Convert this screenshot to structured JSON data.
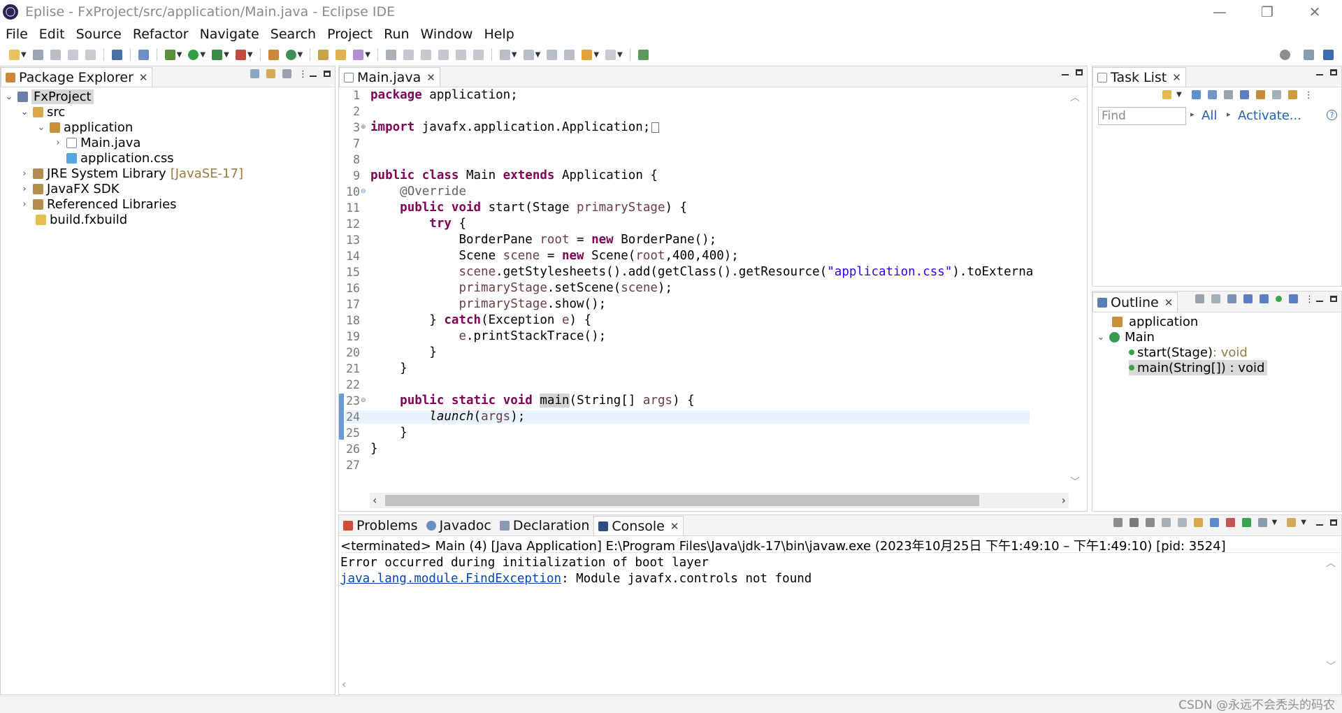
{
  "titlebar": {
    "title": "Eplise - FxProject/src/application/Main.java - Eclipse IDE",
    "minimize_glyph": "—",
    "restore_glyph": "❐",
    "close_glyph": "✕"
  },
  "menu": {
    "items": [
      "File",
      "Edit",
      "Source",
      "Refactor",
      "Navigate",
      "Search",
      "Project",
      "Run",
      "Window",
      "Help"
    ]
  },
  "package_explorer": {
    "tab_label": "Package Explorer",
    "tree": [
      {
        "label": "FxProject",
        "icon": "project-icon"
      },
      {
        "label": "src",
        "icon": "source-folder-icon"
      },
      {
        "label": "application",
        "icon": "package-icon"
      },
      {
        "label": "Main.java",
        "icon": "java-file-icon"
      },
      {
        "label": "application.css",
        "icon": "css-file-icon"
      },
      {
        "label": "JRE System Library",
        "suffix": "[JavaSE-17]",
        "icon": "library-icon"
      },
      {
        "label": "JavaFX SDK",
        "icon": "library-icon"
      },
      {
        "label": "Referenced Libraries",
        "icon": "library-icon"
      },
      {
        "label": "build.fxbuild",
        "icon": "fxbuild-file-icon"
      }
    ]
  },
  "editor": {
    "tab_label": "Main.java",
    "line_numbers": [
      "1",
      "2",
      "3",
      "7",
      "8",
      "9",
      "10",
      "11",
      "12",
      "13",
      "14",
      "15",
      "16",
      "17",
      "18",
      "19",
      "20",
      "21",
      "22",
      "23",
      "24",
      "25",
      "26",
      "27"
    ],
    "code": {
      "l1_kw": "package",
      "l1_rest": " application;",
      "l3_kw": "import",
      "l3_rest": " javafx.application.Application;",
      "l9_kw1": "public",
      "l9_kw2": "class",
      "l9_name": " Main ",
      "l9_kw3": "extends",
      "l9_rest": " Application {",
      "l10_ann": "@Override",
      "l11_kw1": "public",
      "l11_kw2": "void",
      "l11_rest1": " start(Stage ",
      "l11_var": "primaryStage",
      "l11_rest2": ") {",
      "l12_kw": "try",
      "l12_rest": " {",
      "l13_a": "BorderPane ",
      "l13_var": "root",
      "l13_b": " = ",
      "l13_kw": "new",
      "l13_c": " BorderPane();",
      "l14_a": "Scene ",
      "l14_var": "scene",
      "l14_b": " = ",
      "l14_kw": "new",
      "l14_c": " Scene(",
      "l14_var2": "root",
      "l14_d": ",400,400);",
      "l15_var": "scene",
      "l15_a": ".getStylesheets().add(getClass().getResource(",
      "l15_str": "\"application.css\"",
      "l15_b": ").toExterna",
      "l16_var": "primaryStage",
      "l16_a": ".setScene(",
      "l16_var2": "scene",
      "l16_b": ");",
      "l17_var": "primaryStage",
      "l17_a": ".show();",
      "l18_a": "} ",
      "l18_kw": "catch",
      "l18_b": "(Exception ",
      "l18_var": "e",
      "l18_c": ") {",
      "l19_var": "e",
      "l19_a": ".printStackTrace();",
      "l20": "}",
      "l21": "}",
      "l23_kw1": "public",
      "l23_kw2": "static",
      "l23_kw3": "void",
      "l23_sp": " ",
      "l23_name": "main",
      "l23_a": "(String[] ",
      "l23_var": "args",
      "l23_b": ") {",
      "l24_italic": "launch",
      "l24_a": "(",
      "l24_var": "args",
      "l24_b": ");",
      "l25": "}",
      "l26": "}"
    }
  },
  "task_list": {
    "tab_label": "Task List",
    "find_placeholder": "Find",
    "all_label": "All",
    "activate_label": "Activate...",
    "help_glyph": "?"
  },
  "outline": {
    "tab_label": "Outline",
    "items": [
      {
        "label": "application",
        "icon": "package-icon"
      },
      {
        "label": "Main",
        "icon": "class-icon"
      },
      {
        "label": "start(Stage)",
        "suffix": " : void",
        "icon": "method-icon"
      },
      {
        "label": "main(String[]) : void",
        "icon": "static-method-icon"
      }
    ]
  },
  "console_panel": {
    "tabs": [
      "Problems",
      "Javadoc",
      "Declaration",
      "Console"
    ],
    "status_line": "<terminated> Main (4) [Java Application] E:\\Program Files\\Java\\jdk-17\\bin\\javaw.exe  (2023年10月25日 下午1:49:10 – 下午1:49:10) [pid: 3524]",
    "output_line1": "Error occurred during initialization of boot layer",
    "output_link": "java.lang.module.FindException",
    "output_rest": ": Module javafx.controls not found"
  },
  "watermark": "CSDN @永远不会秃头的码农",
  "colors": {
    "keyword": "#7f0055",
    "string": "#2a00ff",
    "field": "#0000c0",
    "local_var": "#6a3e3e",
    "annotation": "#646464",
    "current_line": "#e8f2fe"
  }
}
